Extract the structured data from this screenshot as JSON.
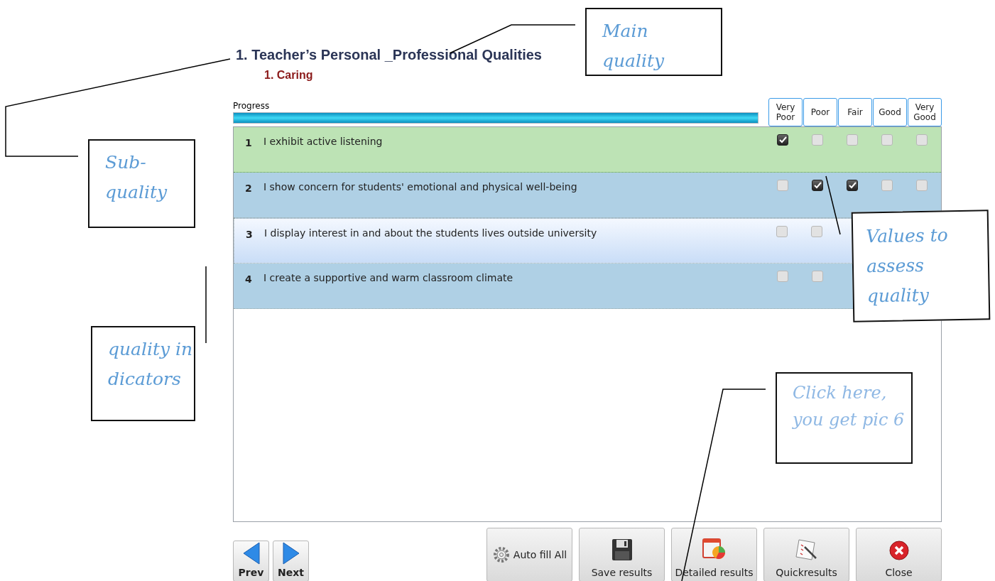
{
  "heading": "1. Teacher’s Personal _Professional Qualities",
  "subheading": "1. Caring",
  "progress": {
    "label": "Progress",
    "level": 1
  },
  "rating_columns": [
    "Very Poor",
    "Poor",
    "Fair",
    "Good",
    "Very Good"
  ],
  "items": [
    {
      "number": "1",
      "text": "I exhibit active listening",
      "complete": true,
      "selected": false,
      "checks": [
        true,
        false,
        false,
        false,
        false
      ]
    },
    {
      "number": "2",
      "text": "I show concern for students' emotional and physical well-being",
      "complete": false,
      "selected": false,
      "checks": [
        false,
        true,
        true,
        false,
        false
      ]
    },
    {
      "number": "3",
      "text": "I display interest in and about the students lives outside university",
      "complete": false,
      "selected": true,
      "checks": [
        false,
        false
      ]
    },
    {
      "number": "4",
      "text": "I create a supportive and warm classroom climate",
      "complete": false,
      "selected": false,
      "checks": [
        false,
        false
      ]
    }
  ],
  "nav_buttons": [
    {
      "kind": "prev",
      "label": "Prev"
    },
    {
      "kind": "next",
      "label": "Next"
    }
  ],
  "action_buttons": [
    {
      "kind": "autofill",
      "label": "Auto fill All"
    },
    {
      "kind": "save",
      "label": "Save results"
    },
    {
      "kind": "detailed",
      "label": "Detailed results"
    },
    {
      "kind": "quick",
      "label": "Quickresults"
    },
    {
      "kind": "close",
      "label": "Close"
    }
  ],
  "callouts": [
    {
      "kind": "main",
      "text": "Main quality"
    },
    {
      "kind": "sub",
      "text": "Sub-quality"
    },
    {
      "kind": "indicators",
      "text": "quality indicators"
    },
    {
      "kind": "values",
      "text": "Values to assess quality"
    },
    {
      "kind": "click",
      "text": "Click here, you get pic 6"
    }
  ]
}
